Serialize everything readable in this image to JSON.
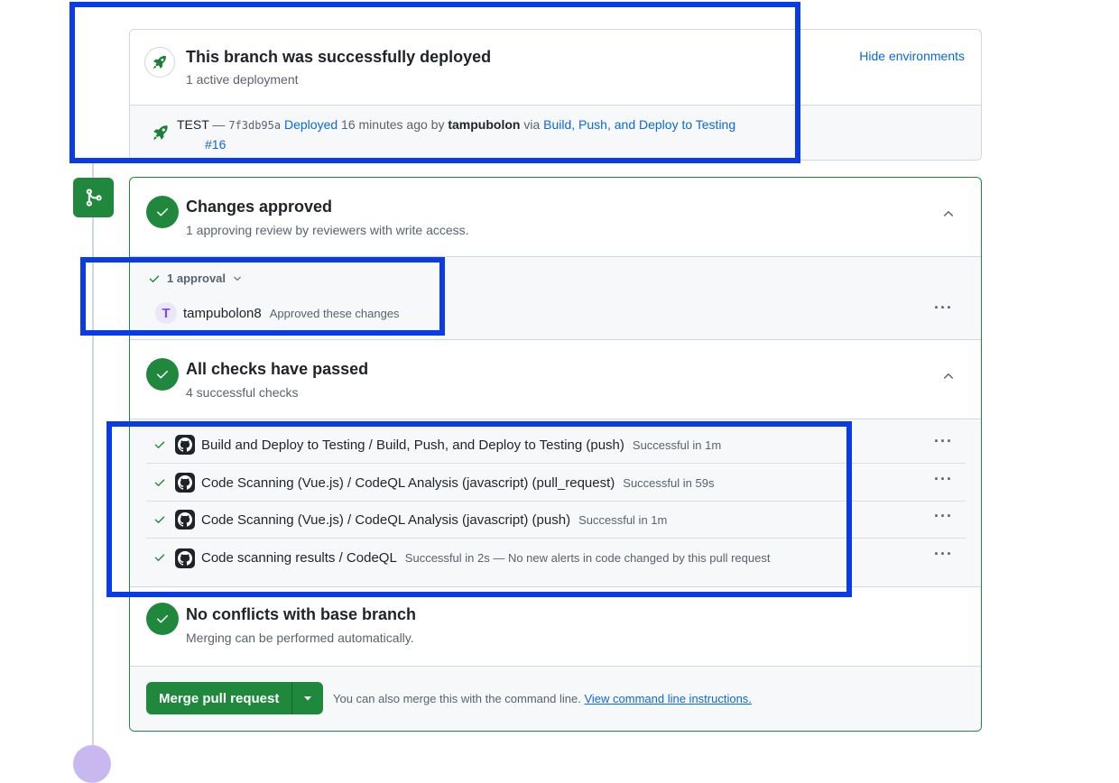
{
  "deployment": {
    "title": "This branch was successfully deployed",
    "subtitle": "1 active deployment",
    "hide_link": "Hide environments",
    "env": "TEST",
    "dash": "—",
    "sha": "7f3db95a",
    "deployed_link": "Deployed",
    "time": "16 minutes ago by",
    "user": "tampubolon",
    "via": "via",
    "workflow_link": "Build, Push, and Deploy to Testing",
    "run_link": "#16"
  },
  "approval": {
    "title": "Changes approved",
    "subtitle": "1 approving review by reviewers with write access.",
    "count_label": "1 approval",
    "reviewer": "tampubolon8",
    "reviewer_note": "Approved these changes",
    "avatar_letter": "T"
  },
  "checks": {
    "title": "All checks have passed",
    "subtitle": "4 successful checks",
    "items": [
      {
        "name": "Build and Deploy to Testing / Build, Push, and Deploy to Testing (push)",
        "status": "Successful in 1m"
      },
      {
        "name": "Code Scanning (Vue.js) / CodeQL Analysis (javascript) (pull_request)",
        "status": "Successful in 59s"
      },
      {
        "name": "Code Scanning (Vue.js) / CodeQL Analysis (javascript) (push)",
        "status": "Successful in 1m"
      },
      {
        "name": "Code scanning results / CodeQL",
        "status": "Successful in 2s — No new alerts in code changed by this pull request"
      }
    ]
  },
  "conflicts": {
    "title": "No conflicts with base branch",
    "subtitle": "Merging can be performed automatically."
  },
  "merge": {
    "button_label": "Merge pull request",
    "hint": "You can also merge this with the command line.",
    "hint_link": "View command line instructions."
  },
  "icons": [
    "rocket-icon",
    "git-merge-icon",
    "check-icon",
    "chevron-up-icon",
    "chevron-down-icon",
    "kebab-icon",
    "github-icon",
    "triangle-down-icon"
  ],
  "colors": {
    "success": "#1f883d",
    "link": "#0969da",
    "annotation": "#0a3be8",
    "border": "#d0d7de"
  }
}
